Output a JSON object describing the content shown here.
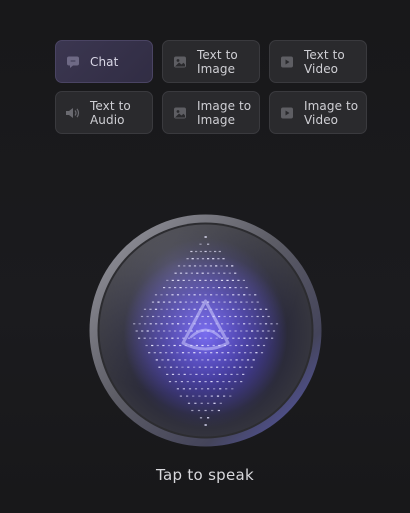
{
  "modes": [
    {
      "label": "Chat",
      "icon": "chat-bubble-icon",
      "active": true
    },
    {
      "label": "Text to\nImage",
      "icon": "image-icon",
      "active": false
    },
    {
      "label": "Text to\nVideo",
      "icon": "video-play-icon",
      "active": false
    },
    {
      "label": "Text to\nAudio",
      "icon": "speaker-icon",
      "active": false
    },
    {
      "label": "Image to\nImage",
      "icon": "image-icon",
      "active": false
    },
    {
      "label": "Image to\nVideo",
      "icon": "video-play-icon",
      "active": false
    }
  ],
  "voice": {
    "prompt": "Tap to speak"
  },
  "colors": {
    "background": "#19191b",
    "tile": "#2a2a2d",
    "tile_active": "#3b3650",
    "accent_glow": "#6a5cff"
  }
}
